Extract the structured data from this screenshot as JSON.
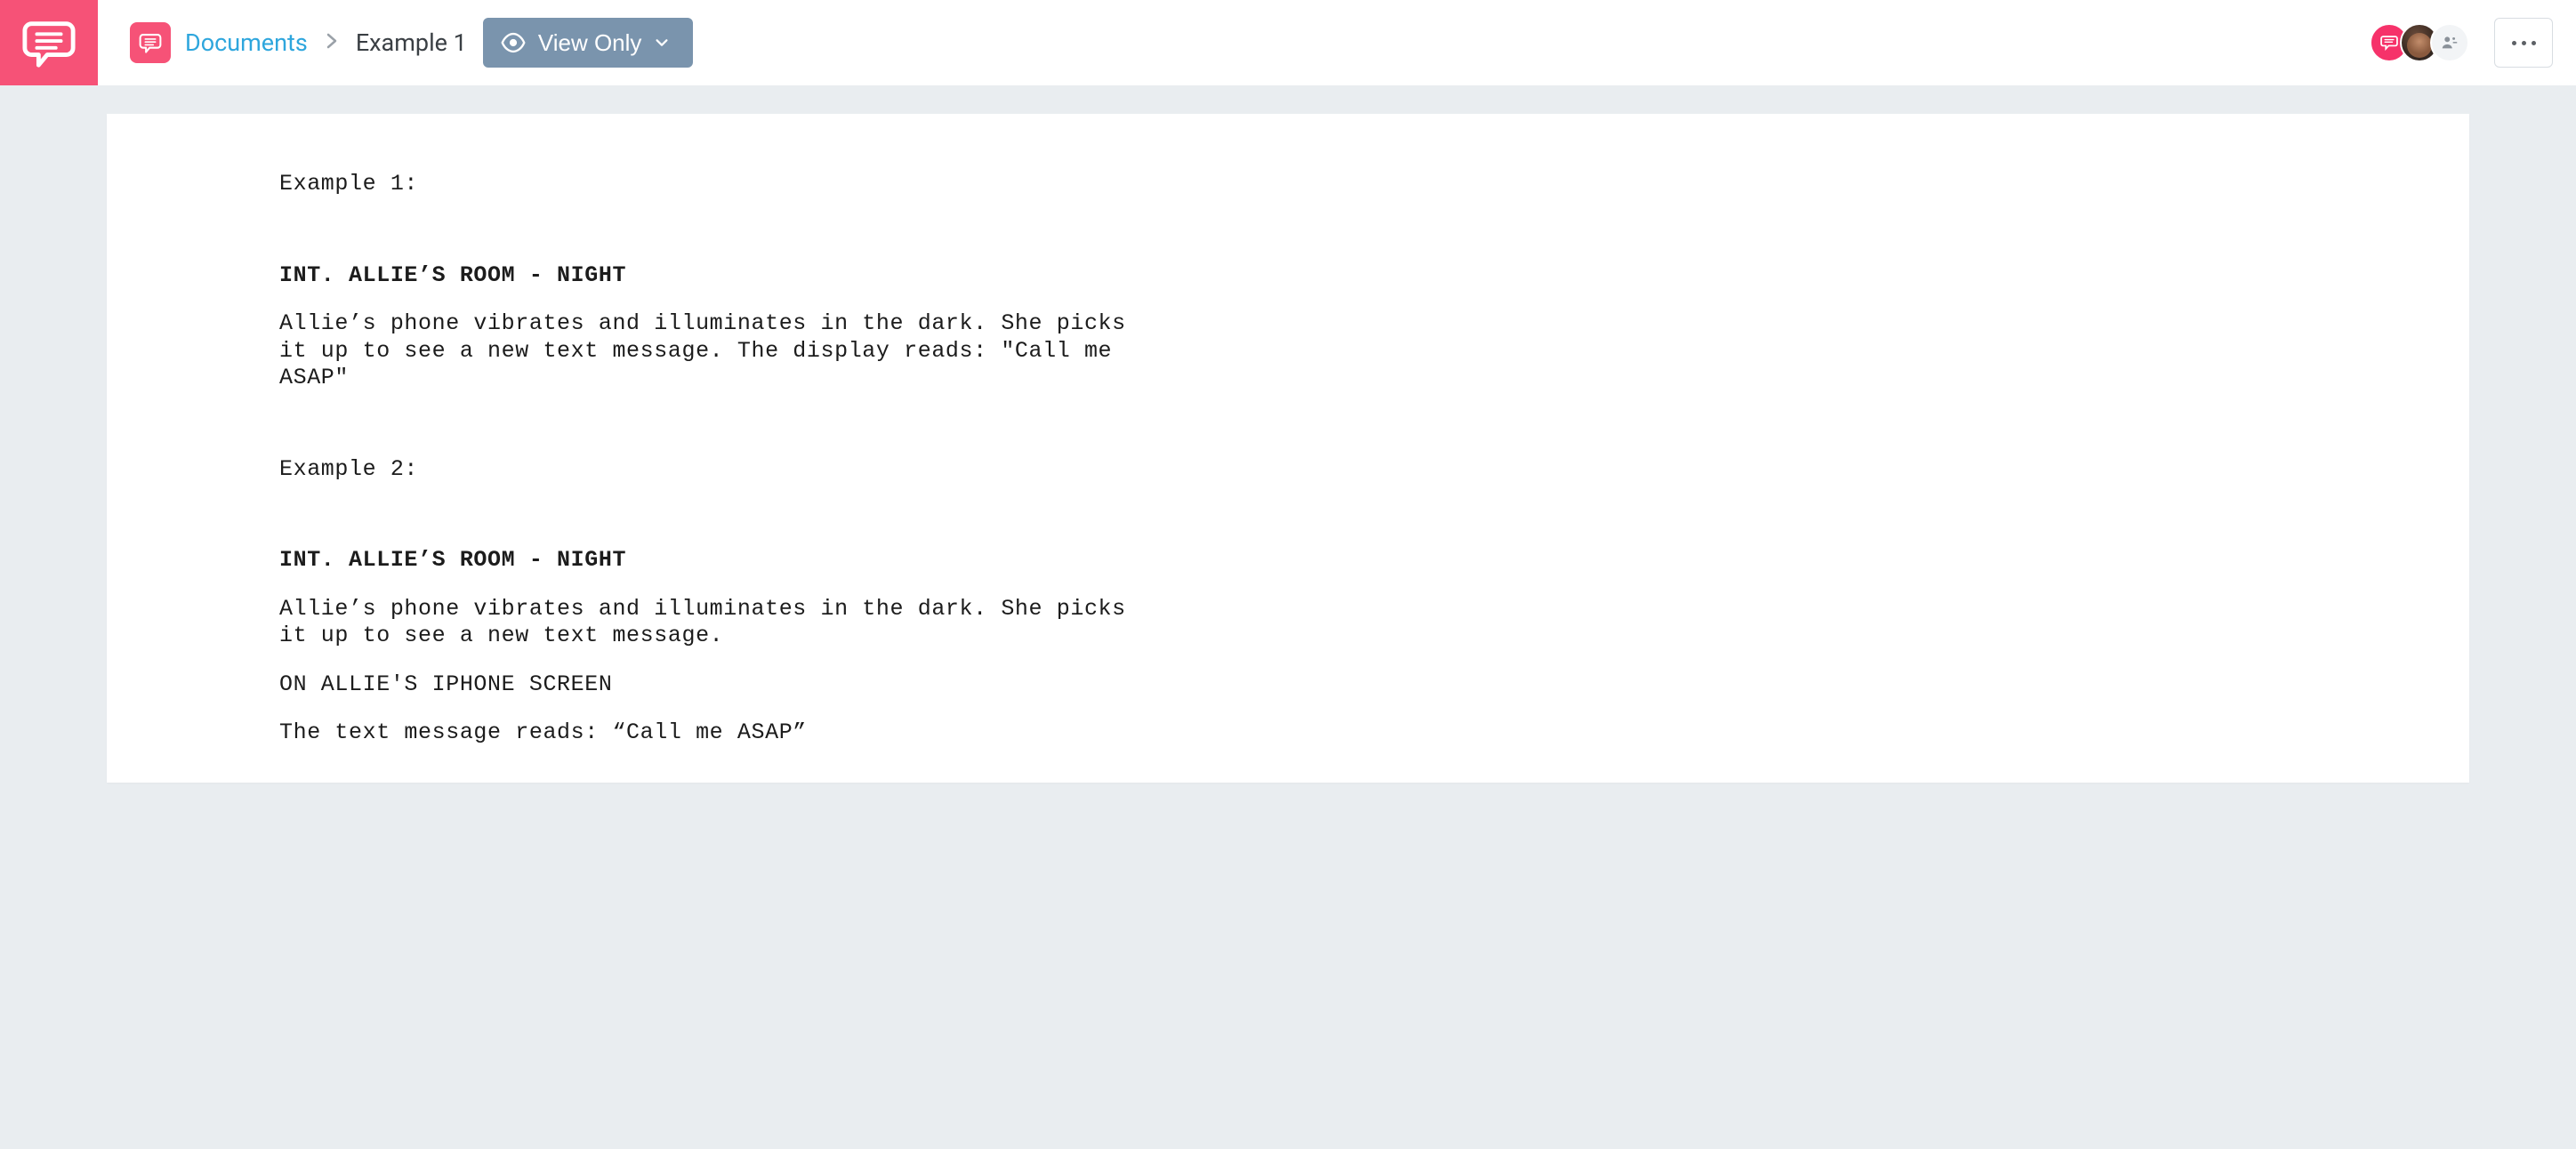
{
  "logo_name": "app-logo",
  "breadcrumb": {
    "root_label": "Documents",
    "current_label": "Example 1"
  },
  "view_button": {
    "label": "View Only"
  },
  "presence": {
    "brand_icon": "chat-bubble-icon",
    "avatar_label": "user-avatar",
    "add_user_label": "add-collaborator"
  },
  "document": {
    "blocks": [
      {
        "type": "plain",
        "text": "Example 1:"
      },
      {
        "type": "gap",
        "size": "lg"
      },
      {
        "type": "slug",
        "text": "INT. ALLIE’S ROOM - NIGHT"
      },
      {
        "type": "gap",
        "size": "sm"
      },
      {
        "type": "plain",
        "text": "Allie’s phone vibrates and illuminates in the dark. She picks it up to see a new text message. The display reads: \"Call me ASAP\""
      },
      {
        "type": "gap",
        "size": "lg"
      },
      {
        "type": "plain",
        "text": "Example 2:"
      },
      {
        "type": "gap",
        "size": "lg"
      },
      {
        "type": "slug",
        "text": "INT. ALLIE’S ROOM - NIGHT"
      },
      {
        "type": "gap",
        "size": "sm"
      },
      {
        "type": "plain",
        "text": "Allie’s phone vibrates and illuminates in the dark. She picks it up to see a new text message."
      },
      {
        "type": "gap",
        "size": "sm"
      },
      {
        "type": "plain",
        "text": "ON ALLIE'S IPHONE SCREEN"
      },
      {
        "type": "gap",
        "size": "sm"
      },
      {
        "type": "plain",
        "text": "The text message reads: “Call me ASAP”"
      }
    ]
  }
}
